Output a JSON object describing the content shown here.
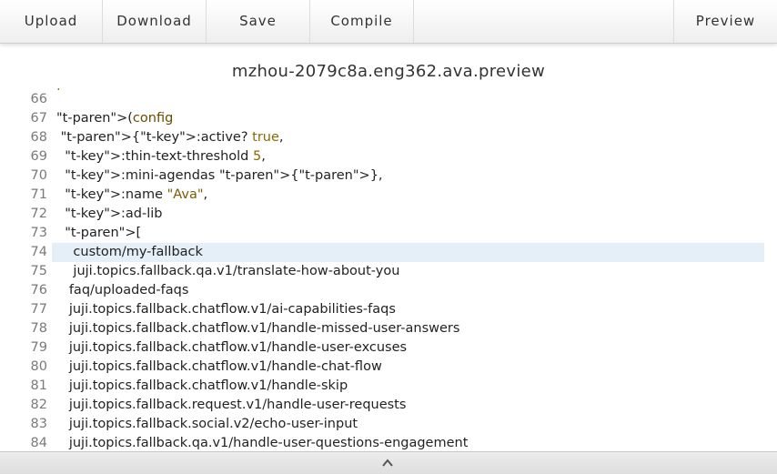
{
  "toolbar": {
    "upload": "Upload",
    "download": "Download",
    "save": "Save",
    "compile": "Compile",
    "preview": "Preview"
  },
  "document": {
    "title": "mzhou-2079c8a.eng362.ava.preview",
    "clipped_fragment": ";"
  },
  "lines": [
    {
      "num": "66",
      "code": ""
    },
    {
      "num": "67",
      "code": "(config"
    },
    {
      "num": "68",
      "code": " {:active? true,"
    },
    {
      "num": "69",
      "code": "  :thin-text-threshold 5,"
    },
    {
      "num": "70",
      "code": "  :mini-agendas {},"
    },
    {
      "num": "71",
      "code": "  :name \"Ava\","
    },
    {
      "num": "72",
      "code": "  :ad-lib"
    },
    {
      "num": "73",
      "code": "  ["
    },
    {
      "num": "74",
      "code": "    custom/my-fallback"
    },
    {
      "num": "75",
      "code": "    juji.topics.fallback.qa.v1/translate-how-about-you"
    },
    {
      "num": "76",
      "code": "   faq/uploaded-faqs"
    },
    {
      "num": "77",
      "code": "   juji.topics.fallback.chatflow.v1/ai-capabilities-faqs"
    },
    {
      "num": "78",
      "code": "   juji.topics.fallback.chatflow.v1/handle-missed-user-answers"
    },
    {
      "num": "79",
      "code": "   juji.topics.fallback.chatflow.v1/handle-user-excuses"
    },
    {
      "num": "80",
      "code": "   juji.topics.fallback.chatflow.v1/handle-chat-flow"
    },
    {
      "num": "81",
      "code": "   juji.topics.fallback.chatflow.v1/handle-skip"
    },
    {
      "num": "82",
      "code": "   juji.topics.fallback.request.v1/handle-user-requests"
    },
    {
      "num": "83",
      "code": "   juji.topics.fallback.social.v2/echo-user-input"
    },
    {
      "num": "84",
      "code": "   juji.topics.fallback.qa.v1/handle-user-questions-engagement"
    }
  ],
  "highlighted_line": "74",
  "colors": {
    "paren": "#9c32c8",
    "keyword": "#8a6a00",
    "highlight": "#e5eff8"
  },
  "icons": {
    "collapse": "chevron-up-icon"
  }
}
